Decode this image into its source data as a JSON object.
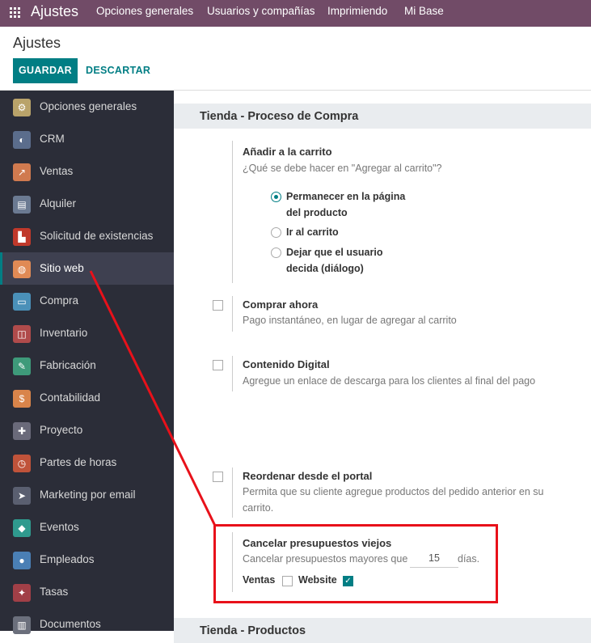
{
  "navbar": {
    "app_title": "Ajustes",
    "menus": [
      "Opciones generales",
      "Usuarios y compañías",
      "Imprimiendo",
      "Mi Base"
    ]
  },
  "control_panel": {
    "title": "Ajustes",
    "save_label": "GUARDAR",
    "discard_label": "DESCARTAR"
  },
  "sidebar": {
    "items": [
      {
        "label": "Opciones generales",
        "icon": "gear-icon",
        "color": "#b9a36a"
      },
      {
        "label": "CRM",
        "icon": "handshake-icon",
        "color": "#5b6d8c"
      },
      {
        "label": "Ventas",
        "icon": "chart-icon",
        "color": "#d07a4f"
      },
      {
        "label": "Alquiler",
        "icon": "rental-icon",
        "color": "#6b7a92"
      },
      {
        "label": "Solicitud de existencias",
        "icon": "forklift-icon",
        "color": "#c0392b"
      },
      {
        "label": "Sitio web",
        "icon": "globe-icon",
        "color": "#e08a55"
      },
      {
        "label": "Compra",
        "icon": "card-icon",
        "color": "#4a90b8"
      },
      {
        "label": "Inventario",
        "icon": "box-icon",
        "color": "#b04b4b"
      },
      {
        "label": "Fabricación",
        "icon": "wrench-icon",
        "color": "#3e9a7a"
      },
      {
        "label": "Contabilidad",
        "icon": "invoice-icon",
        "color": "#d9844a"
      },
      {
        "label": "Proyecto",
        "icon": "puzzle-icon",
        "color": "#6a6a7a"
      },
      {
        "label": "Partes de horas",
        "icon": "timer-icon",
        "color": "#c0533a"
      },
      {
        "label": "Marketing por email",
        "icon": "paper-plane-icon",
        "color": "#5a5f70"
      },
      {
        "label": "Eventos",
        "icon": "ticket-icon",
        "color": "#2f9a8e"
      },
      {
        "label": "Empleados",
        "icon": "people-icon",
        "color": "#4a7fb5"
      },
      {
        "label": "Tasas",
        "icon": "tag-icon",
        "color": "#a13f47"
      },
      {
        "label": "Documentos",
        "icon": "document-icon",
        "color": "#6b6f7c"
      }
    ]
  },
  "sections": {
    "purchase_title": "Tienda - Proceso de Compra",
    "products_title": "Tienda - Productos"
  },
  "add_to_cart": {
    "title": "Añadir a la carrito",
    "description": "¿Qué se debe hacer en \"Agregar al carrito\"?",
    "options": [
      {
        "line1": "Permanecer en la página",
        "line2": "del producto",
        "selected": true
      },
      {
        "line1": "Ir al carrito",
        "line2": "",
        "selected": false
      },
      {
        "line1": "Dejar que el usuario",
        "line2": "decida (diálogo)",
        "selected": false
      }
    ]
  },
  "buy_now": {
    "title": "Comprar ahora",
    "description": "Pago instantáneo, en lugar de agregar al carrito",
    "checked": false
  },
  "digital_content": {
    "title": "Contenido Digital",
    "description": "Agregue un enlace de descarga para los clientes al final del pago",
    "checked": false
  },
  "reorder": {
    "title": "Reordenar desde el portal",
    "description_line1": "Permita que su cliente agregue productos del pedido anterior en su",
    "description_line2": "carrito.",
    "checked": false
  },
  "cancel_quotes": {
    "title": "Cancelar presupuestos viejos",
    "description": "Cancelar presupuestos mayores que",
    "days_value": "15",
    "days_unit": "días.",
    "sales_label": "Ventas",
    "sales_checked": false,
    "website_label": "Website",
    "website_checked": true
  },
  "annotation_color": "#e8111a",
  "accent_color": "#017e84",
  "navbar_color": "#714B67"
}
